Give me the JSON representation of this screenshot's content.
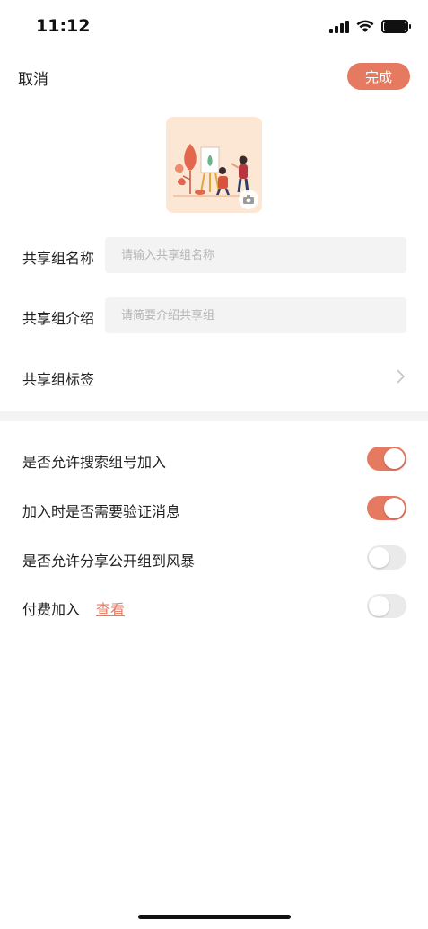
{
  "status_bar": {
    "time": "11:12"
  },
  "nav": {
    "cancel_label": "取消",
    "done_label": "完成"
  },
  "cover": {
    "icon": "camera-icon"
  },
  "form": {
    "name_label": "共享组名称",
    "name_placeholder": "请输入共享组名称",
    "intro_label": "共享组介绍",
    "intro_placeholder": "请简要介绍共享组",
    "tags_label": "共享组标签"
  },
  "settings": {
    "items": [
      {
        "label": "是否允许搜索组号加入",
        "enabled": true
      },
      {
        "label": "加入时是否需要验证消息",
        "enabled": true
      },
      {
        "label": "是否允许分享公开组到风暴",
        "enabled": false
      },
      {
        "label": "付费加入",
        "enabled": false,
        "link": "查看"
      }
    ]
  },
  "colors": {
    "accent": "#e57a61",
    "field_bg": "#f3f3f3"
  }
}
